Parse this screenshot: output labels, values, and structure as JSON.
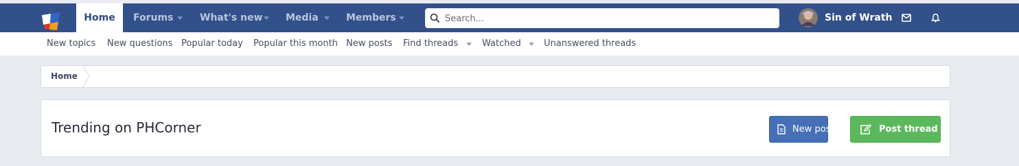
{
  "nav": {
    "tabs": [
      {
        "label": "Home"
      },
      {
        "label": "Forums"
      },
      {
        "label": "What's new"
      },
      {
        "label": "Media"
      },
      {
        "label": "Members"
      }
    ],
    "search_placeholder": "Search...",
    "user_name": "Sin of Wrath"
  },
  "subnav": {
    "items": [
      {
        "label": "New topics"
      },
      {
        "label": "New questions"
      },
      {
        "label": "Popular today"
      },
      {
        "label": "Popular this month"
      },
      {
        "label": "New posts"
      },
      {
        "label": "Find threads"
      },
      {
        "label": "Watched"
      },
      {
        "label": "Unanswered threads"
      }
    ]
  },
  "breadcrumb": {
    "home": "Home"
  },
  "main": {
    "title": "Trending on PHCorner",
    "new_posts_label": "New posts",
    "post_thread_label": "Post thread"
  },
  "colors": {
    "topbar": "#32508a",
    "new_posts_button": "#4670b5",
    "post_thread_button": "#5cb85c"
  },
  "icons": [
    "logo",
    "search-icon",
    "avatar",
    "envelope-icon",
    "bell-icon",
    "document-icon",
    "edit-icon"
  ]
}
